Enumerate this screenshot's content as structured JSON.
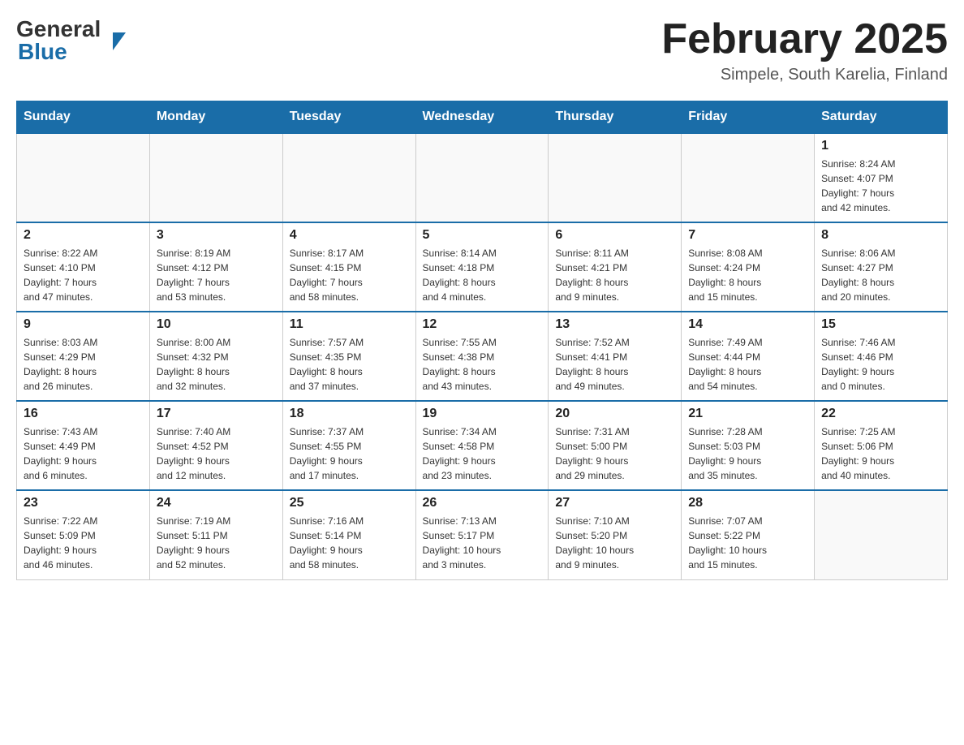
{
  "header": {
    "logo_general": "General",
    "logo_blue": "Blue",
    "month_title": "February 2025",
    "location": "Simpele, South Karelia, Finland"
  },
  "days_of_week": [
    "Sunday",
    "Monday",
    "Tuesday",
    "Wednesday",
    "Thursday",
    "Friday",
    "Saturday"
  ],
  "weeks": [
    {
      "days": [
        {
          "number": "",
          "info": ""
        },
        {
          "number": "",
          "info": ""
        },
        {
          "number": "",
          "info": ""
        },
        {
          "number": "",
          "info": ""
        },
        {
          "number": "",
          "info": ""
        },
        {
          "number": "",
          "info": ""
        },
        {
          "number": "1",
          "info": "Sunrise: 8:24 AM\nSunset: 4:07 PM\nDaylight: 7 hours\nand 42 minutes."
        }
      ]
    },
    {
      "days": [
        {
          "number": "2",
          "info": "Sunrise: 8:22 AM\nSunset: 4:10 PM\nDaylight: 7 hours\nand 47 minutes."
        },
        {
          "number": "3",
          "info": "Sunrise: 8:19 AM\nSunset: 4:12 PM\nDaylight: 7 hours\nand 53 minutes."
        },
        {
          "number": "4",
          "info": "Sunrise: 8:17 AM\nSunset: 4:15 PM\nDaylight: 7 hours\nand 58 minutes."
        },
        {
          "number": "5",
          "info": "Sunrise: 8:14 AM\nSunset: 4:18 PM\nDaylight: 8 hours\nand 4 minutes."
        },
        {
          "number": "6",
          "info": "Sunrise: 8:11 AM\nSunset: 4:21 PM\nDaylight: 8 hours\nand 9 minutes."
        },
        {
          "number": "7",
          "info": "Sunrise: 8:08 AM\nSunset: 4:24 PM\nDaylight: 8 hours\nand 15 minutes."
        },
        {
          "number": "8",
          "info": "Sunrise: 8:06 AM\nSunset: 4:27 PM\nDaylight: 8 hours\nand 20 minutes."
        }
      ]
    },
    {
      "days": [
        {
          "number": "9",
          "info": "Sunrise: 8:03 AM\nSunset: 4:29 PM\nDaylight: 8 hours\nand 26 minutes."
        },
        {
          "number": "10",
          "info": "Sunrise: 8:00 AM\nSunset: 4:32 PM\nDaylight: 8 hours\nand 32 minutes."
        },
        {
          "number": "11",
          "info": "Sunrise: 7:57 AM\nSunset: 4:35 PM\nDaylight: 8 hours\nand 37 minutes."
        },
        {
          "number": "12",
          "info": "Sunrise: 7:55 AM\nSunset: 4:38 PM\nDaylight: 8 hours\nand 43 minutes."
        },
        {
          "number": "13",
          "info": "Sunrise: 7:52 AM\nSunset: 4:41 PM\nDaylight: 8 hours\nand 49 minutes."
        },
        {
          "number": "14",
          "info": "Sunrise: 7:49 AM\nSunset: 4:44 PM\nDaylight: 8 hours\nand 54 minutes."
        },
        {
          "number": "15",
          "info": "Sunrise: 7:46 AM\nSunset: 4:46 PM\nDaylight: 9 hours\nand 0 minutes."
        }
      ]
    },
    {
      "days": [
        {
          "number": "16",
          "info": "Sunrise: 7:43 AM\nSunset: 4:49 PM\nDaylight: 9 hours\nand 6 minutes."
        },
        {
          "number": "17",
          "info": "Sunrise: 7:40 AM\nSunset: 4:52 PM\nDaylight: 9 hours\nand 12 minutes."
        },
        {
          "number": "18",
          "info": "Sunrise: 7:37 AM\nSunset: 4:55 PM\nDaylight: 9 hours\nand 17 minutes."
        },
        {
          "number": "19",
          "info": "Sunrise: 7:34 AM\nSunset: 4:58 PM\nDaylight: 9 hours\nand 23 minutes."
        },
        {
          "number": "20",
          "info": "Sunrise: 7:31 AM\nSunset: 5:00 PM\nDaylight: 9 hours\nand 29 minutes."
        },
        {
          "number": "21",
          "info": "Sunrise: 7:28 AM\nSunset: 5:03 PM\nDaylight: 9 hours\nand 35 minutes."
        },
        {
          "number": "22",
          "info": "Sunrise: 7:25 AM\nSunset: 5:06 PM\nDaylight: 9 hours\nand 40 minutes."
        }
      ]
    },
    {
      "days": [
        {
          "number": "23",
          "info": "Sunrise: 7:22 AM\nSunset: 5:09 PM\nDaylight: 9 hours\nand 46 minutes."
        },
        {
          "number": "24",
          "info": "Sunrise: 7:19 AM\nSunset: 5:11 PM\nDaylight: 9 hours\nand 52 minutes."
        },
        {
          "number": "25",
          "info": "Sunrise: 7:16 AM\nSunset: 5:14 PM\nDaylight: 9 hours\nand 58 minutes."
        },
        {
          "number": "26",
          "info": "Sunrise: 7:13 AM\nSunset: 5:17 PM\nDaylight: 10 hours\nand 3 minutes."
        },
        {
          "number": "27",
          "info": "Sunrise: 7:10 AM\nSunset: 5:20 PM\nDaylight: 10 hours\nand 9 minutes."
        },
        {
          "number": "28",
          "info": "Sunrise: 7:07 AM\nSunset: 5:22 PM\nDaylight: 10 hours\nand 15 minutes."
        },
        {
          "number": "",
          "info": ""
        }
      ]
    }
  ]
}
